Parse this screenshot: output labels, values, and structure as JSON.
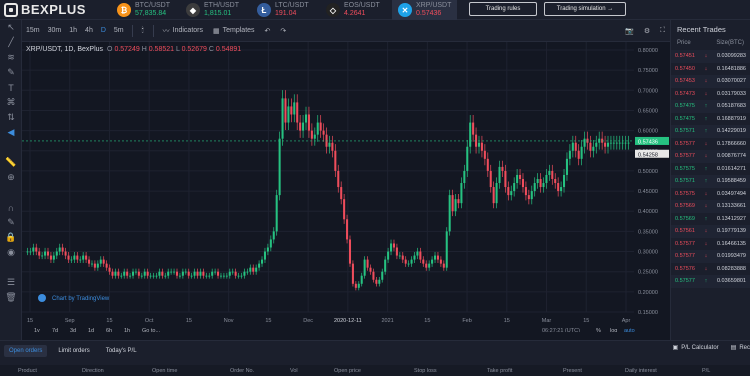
{
  "brand": {
    "name": "BEXPLUS"
  },
  "tickers": [
    {
      "symbol": "BTC/USDT",
      "price": "57,835.84",
      "dir": "up",
      "icon": "bitcoin-icon",
      "glyph": "₿",
      "color": "#f7931a"
    },
    {
      "symbol": "ETH/USDT",
      "price": "1,815.01",
      "dir": "up",
      "icon": "ethereum-icon",
      "glyph": "◆",
      "color": "#3c3c3d"
    },
    {
      "symbol": "LTC/USDT",
      "price": "191.04",
      "dir": "down",
      "icon": "litecoin-icon",
      "glyph": "Ł",
      "color": "#345d9d"
    },
    {
      "symbol": "EOS/USDT",
      "price": "4.2641",
      "dir": "down",
      "icon": "eos-icon",
      "glyph": "◇",
      "color": "#222"
    },
    {
      "symbol": "XRP/USDT",
      "price": "0.57436",
      "dir": "down",
      "icon": "xrp-icon",
      "glyph": "✕",
      "color": "#1ea2e8"
    }
  ],
  "top_buttons": {
    "trading_rules": "Trading rules",
    "trading_simulation": "Trading simulation"
  },
  "chart_toolbar": {
    "timeframes": [
      "15m",
      "30m",
      "1h",
      "4h",
      "D",
      "5m"
    ],
    "selected": "D",
    "indicators": "Indicators",
    "templates": "Templates"
  },
  "legend": {
    "symbol": "XRP/USDT, 1D, BexPlus",
    "o": "0.57249",
    "h": "0.58521",
    "l": "0.52679",
    "c": "0.54891"
  },
  "watermark": "Chart by TradingView",
  "bottom_axis": {
    "ranges": [
      "1y",
      "7d",
      "3d",
      "1d",
      "6h",
      "1h",
      "Go to..."
    ],
    "time": "06:27:21 (UTC)",
    "toggles": [
      "%",
      "log",
      "auto"
    ],
    "x_labels": [
      "15",
      "Sep",
      "15",
      "Oct",
      "15",
      "Nov",
      "15",
      "Dec",
      "2020-12-11",
      "2021",
      "15",
      "Feb",
      "15",
      "Mar",
      "15",
      "Apr"
    ]
  },
  "price_scale": {
    "labels": [
      "0.80000",
      "0.75000",
      "0.70000",
      "0.65000",
      "0.60000",
      "0.55000",
      "0.50000",
      "0.45000",
      "0.40000",
      "0.35000",
      "0.30000",
      "0.25000",
      "0.20000",
      "0.15000"
    ],
    "current": "0.57436",
    "marker": "0.54258"
  },
  "recent_trades": {
    "title": "Recent Trades",
    "col_price": "Price",
    "col_size": "Size(BTC)",
    "rows": [
      {
        "price": "0.57451",
        "dir": "down",
        "size": "0.03099283"
      },
      {
        "price": "0.57450",
        "dir": "down",
        "size": "0.16481886"
      },
      {
        "price": "0.57453",
        "dir": "down",
        "size": "0.03070027"
      },
      {
        "price": "0.57473",
        "dir": "down",
        "size": "0.03179033"
      },
      {
        "price": "0.57475",
        "dir": "up",
        "size": "0.05187683"
      },
      {
        "price": "0.57475",
        "dir": "up",
        "size": "0.16887919"
      },
      {
        "price": "0.57571",
        "dir": "up",
        "size": "0.14229019"
      },
      {
        "price": "0.57577",
        "dir": "down",
        "size": "0.17866660"
      },
      {
        "price": "0.57577",
        "dir": "down",
        "size": "0.00876774"
      },
      {
        "price": "0.57575",
        "dir": "up",
        "size": "0.01614271"
      },
      {
        "price": "0.57571",
        "dir": "up",
        "size": "0.19588459"
      },
      {
        "price": "0.57575",
        "dir": "down",
        "size": "0.03497494"
      },
      {
        "price": "0.57569",
        "dir": "down",
        "size": "0.13133661"
      },
      {
        "price": "0.57569",
        "dir": "up",
        "size": "0.13412927"
      },
      {
        "price": "0.57561",
        "dir": "down",
        "size": "0.19779139"
      },
      {
        "price": "0.57577",
        "dir": "down",
        "size": "0.16466135"
      },
      {
        "price": "0.57577",
        "dir": "down",
        "size": "0.01993479"
      },
      {
        "price": "0.57576",
        "dir": "down",
        "size": "0.08283888"
      },
      {
        "price": "0.57577",
        "dir": "up",
        "size": "0.03659801"
      }
    ]
  },
  "bottom_tabs": {
    "open_orders": "Open orders",
    "limit_orders": "Limit orders",
    "todays_pl": "Today's P/L"
  },
  "bottom_right": {
    "pl_calc": "P/L Calculator",
    "rec": "Rec"
  },
  "order_columns": [
    "Product",
    "Direction",
    "Open time",
    "Order No.",
    "Vol",
    "Open price",
    "Stop loss",
    "Take profit",
    "Present",
    "Daily interest",
    "P/L"
  ],
  "colors": {
    "up": "#26c281",
    "down": "#ef4d5c",
    "accent": "#3c8dde",
    "bg": "#131722"
  },
  "chart_data": {
    "type": "line",
    "title": "XRP/USDT, 1D, BexPlus",
    "x_start": "2020-08-01",
    "x_end": "2021-04-03",
    "ylim": [
      0.15,
      0.8
    ],
    "grid": true,
    "close": [
      0.3,
      0.3,
      0.31,
      0.3,
      0.29,
      0.29,
      0.3,
      0.29,
      0.28,
      0.29,
      0.3,
      0.31,
      0.3,
      0.29,
      0.28,
      0.28,
      0.29,
      0.28,
      0.28,
      0.29,
      0.28,
      0.27,
      0.27,
      0.26,
      0.27,
      0.28,
      0.27,
      0.26,
      0.25,
      0.24,
      0.25,
      0.24,
      0.24,
      0.25,
      0.24,
      0.24,
      0.25,
      0.25,
      0.24,
      0.24,
      0.25,
      0.24,
      0.24,
      0.24,
      0.24,
      0.25,
      0.24,
      0.24,
      0.25,
      0.25,
      0.25,
      0.24,
      0.24,
      0.25,
      0.25,
      0.24,
      0.24,
      0.25,
      0.24,
      0.25,
      0.24,
      0.24,
      0.24,
      0.25,
      0.25,
      0.24,
      0.24,
      0.24,
      0.24,
      0.25,
      0.25,
      0.24,
      0.24,
      0.24,
      0.25,
      0.25,
      0.26,
      0.25,
      0.26,
      0.27,
      0.28,
      0.3,
      0.31,
      0.33,
      0.35,
      0.44,
      0.58,
      0.68,
      0.62,
      0.66,
      0.64,
      0.67,
      0.62,
      0.6,
      0.62,
      0.64,
      0.6,
      0.58,
      0.59,
      0.62,
      0.6,
      0.59,
      0.56,
      0.57,
      0.55,
      0.5,
      0.46,
      0.43,
      0.38,
      0.33,
      0.27,
      0.22,
      0.21,
      0.22,
      0.24,
      0.28,
      0.26,
      0.25,
      0.23,
      0.22,
      0.23,
      0.25,
      0.28,
      0.3,
      0.32,
      0.31,
      0.29,
      0.29,
      0.28,
      0.27,
      0.27,
      0.28,
      0.29,
      0.3,
      0.28,
      0.27,
      0.26,
      0.27,
      0.28,
      0.29,
      0.28,
      0.27,
      0.26,
      0.35,
      0.44,
      0.4,
      0.43,
      0.42,
      0.47,
      0.5,
      0.56,
      0.62,
      0.59,
      0.56,
      0.57,
      0.55,
      0.53,
      0.5,
      0.46,
      0.42,
      0.47,
      0.51,
      0.5,
      0.46,
      0.44,
      0.45,
      0.47,
      0.49,
      0.48,
      0.46,
      0.44,
      0.43,
      0.45,
      0.47,
      0.48,
      0.46,
      0.47,
      0.49,
      0.5,
      0.48,
      0.47,
      0.45,
      0.46,
      0.49,
      0.53,
      0.55,
      0.57,
      0.55,
      0.53,
      0.56,
      0.58,
      0.57,
      0.55,
      0.56,
      0.57,
      0.58,
      0.57,
      0.56,
      0.57,
      0.57,
      0.57,
      0.57,
      0.57,
      0.57,
      0.57,
      0.57
    ]
  }
}
